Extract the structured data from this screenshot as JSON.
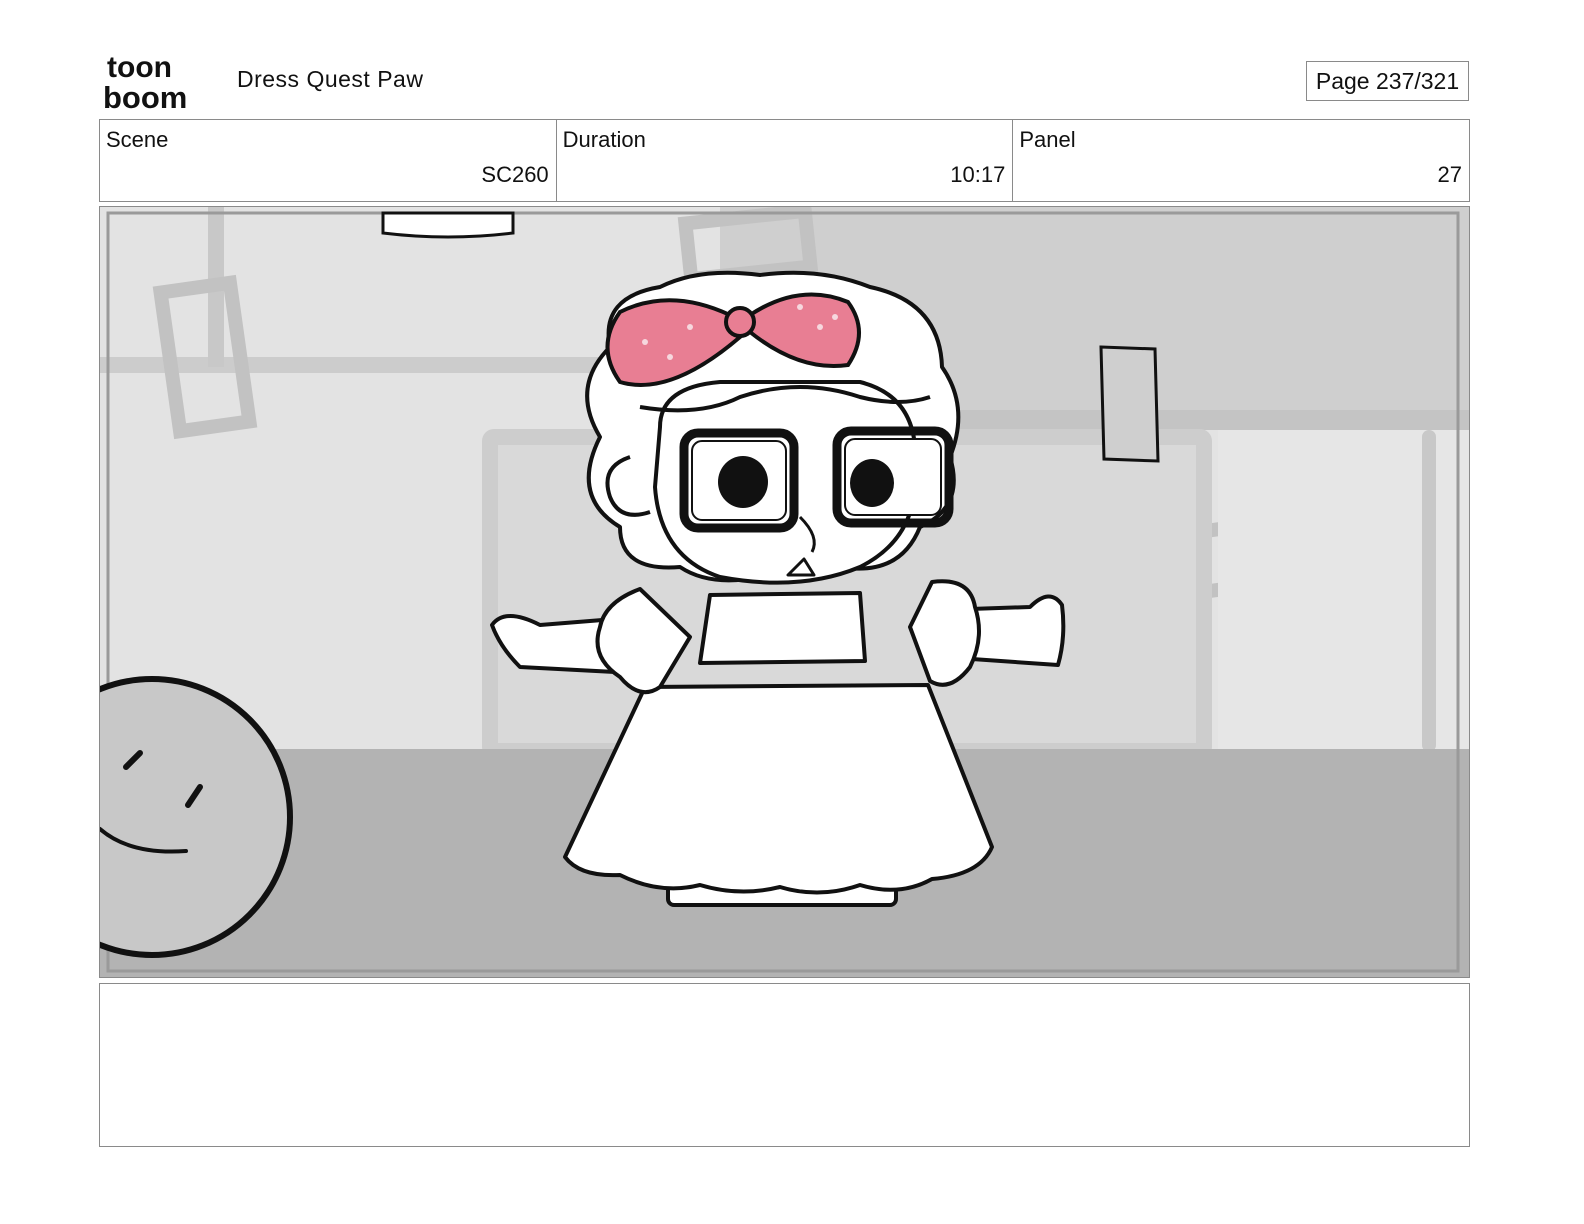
{
  "header": {
    "logo_text_top": "toon",
    "logo_text_bottom": "boom",
    "project_title": "Dress Quest Paw",
    "page_label": "Page 237/321"
  },
  "info": {
    "scene_label": "Scene",
    "scene_value": "SC260",
    "duration_label": "Duration",
    "duration_value": "10:17",
    "panel_label": "Panel",
    "panel_value": "27"
  },
  "panel_image": {
    "description_icon": "storyboard-drawing",
    "colors": {
      "bow": "#e87e93",
      "wall": "#e3e3e3",
      "floor": "#b3b3b3",
      "accent_wall": "#cfcfcf"
    }
  },
  "notes": {
    "text": ""
  }
}
